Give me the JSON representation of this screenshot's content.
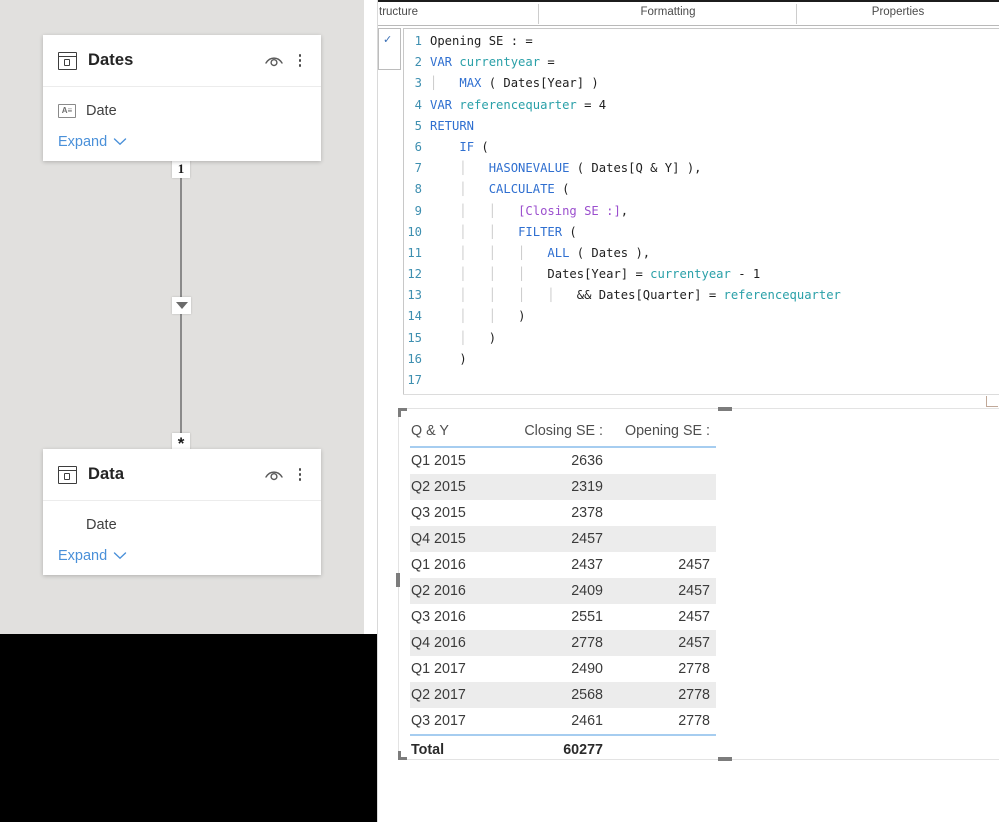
{
  "ribbon": {
    "groups": [
      {
        "label": "tructure",
        "name": "ribbon-group-structure"
      },
      {
        "label": "Formatting",
        "name": "ribbon-group-formatting"
      },
      {
        "label": "Properties",
        "name": "ribbon-group-properties"
      }
    ]
  },
  "formula_bar": {
    "commit_icon": "checkmark-icon",
    "commit_glyph": "✓"
  },
  "model_pane": {
    "tables": [
      {
        "name": "Dates",
        "icon": "table-icon",
        "hide_icon": "eye-hide-icon",
        "more_icon": "kebab-menu-icon",
        "fields": [
          {
            "label": "Date",
            "icon": "text-field-icon",
            "icon_text": "A≡"
          }
        ],
        "expand_label": "Expand",
        "expand_icon": "chevron-down-icon"
      },
      {
        "name": "Data",
        "icon": "table-icon",
        "hide_icon": "eye-hide-icon",
        "more_icon": "kebab-menu-icon",
        "fields": [
          {
            "label": "Date",
            "icon": "",
            "icon_text": ""
          }
        ],
        "expand_label": "Expand",
        "expand_icon": "chevron-down-icon"
      }
    ],
    "relationship": {
      "from_cardinality": "1",
      "to_cardinality": "*",
      "cross_filter_icon": "filter-direction-arrow-icon"
    }
  },
  "code": {
    "lines": [
      {
        "n": "1",
        "tokens": [
          {
            "t": "Opening SE : =",
            "c": "ctext"
          }
        ]
      },
      {
        "n": "2",
        "tokens": [
          {
            "t": "VAR ",
            "c": "k-fn"
          },
          {
            "t": "currentyear",
            "c": "k-var"
          },
          {
            "t": " =",
            "c": "ctext"
          }
        ]
      },
      {
        "n": "3",
        "tokens": [
          {
            "t": "│   ",
            "c": "guide"
          },
          {
            "t": "MAX",
            "c": "k-fn"
          },
          {
            "t": " ( Dates[Year] )",
            "c": "ctext"
          }
        ]
      },
      {
        "n": "4",
        "tokens": [
          {
            "t": "VAR ",
            "c": "k-fn"
          },
          {
            "t": "referencequarter",
            "c": "k-var"
          },
          {
            "t": " = 4",
            "c": "ctext"
          }
        ]
      },
      {
        "n": "5",
        "tokens": [
          {
            "t": "RETURN",
            "c": "k-fn"
          }
        ]
      },
      {
        "n": "6",
        "tokens": [
          {
            "t": "    ",
            "c": "ctext"
          },
          {
            "t": "IF",
            "c": "k-fn"
          },
          {
            "t": " (",
            "c": "ctext"
          }
        ]
      },
      {
        "n": "7",
        "tokens": [
          {
            "t": "    │   ",
            "c": "guide"
          },
          {
            "t": "HASONEVALUE",
            "c": "k-fn"
          },
          {
            "t": " ( Dates[Q & Y] ),",
            "c": "ctext"
          }
        ]
      },
      {
        "n": "8",
        "tokens": [
          {
            "t": "    │   ",
            "c": "guide"
          },
          {
            "t": "CALCULATE",
            "c": "k-fn"
          },
          {
            "t": " (",
            "c": "ctext"
          }
        ]
      },
      {
        "n": "9",
        "tokens": [
          {
            "t": "    │   │   ",
            "c": "guide"
          },
          {
            "t": "[Closing SE :]",
            "c": "k-meas"
          },
          {
            "t": ",",
            "c": "ctext"
          }
        ]
      },
      {
        "n": "10",
        "tokens": [
          {
            "t": "    │   │   ",
            "c": "guide"
          },
          {
            "t": "FILTER",
            "c": "k-fn"
          },
          {
            "t": " (",
            "c": "ctext"
          }
        ]
      },
      {
        "n": "11",
        "tokens": [
          {
            "t": "    │   │   │   ",
            "c": "guide"
          },
          {
            "t": "ALL",
            "c": "k-fn"
          },
          {
            "t": " ( Dates ),",
            "c": "ctext"
          }
        ]
      },
      {
        "n": "12",
        "tokens": [
          {
            "t": "    │   │   │   ",
            "c": "guide"
          },
          {
            "t": "Dates[Year] = ",
            "c": "ctext"
          },
          {
            "t": "currentyear",
            "c": "k-var"
          },
          {
            "t": " - 1",
            "c": "ctext"
          }
        ]
      },
      {
        "n": "13",
        "tokens": [
          {
            "t": "    │   │   │   │   ",
            "c": "guide"
          },
          {
            "t": "&& Dates[Quarter] = ",
            "c": "ctext"
          },
          {
            "t": "referencequarter",
            "c": "k-var"
          }
        ]
      },
      {
        "n": "14",
        "tokens": [
          {
            "t": "    │   │   ",
            "c": "guide"
          },
          {
            "t": ")",
            "c": "ctext"
          }
        ]
      },
      {
        "n": "15",
        "tokens": [
          {
            "t": "    │   ",
            "c": "guide"
          },
          {
            "t": ")",
            "c": "ctext"
          }
        ]
      },
      {
        "n": "16",
        "tokens": [
          {
            "t": "    ",
            "c": "guide"
          },
          {
            "t": ")",
            "c": "ctext"
          }
        ]
      },
      {
        "n": "17",
        "tokens": [
          {
            "t": "",
            "c": "ctext"
          }
        ]
      }
    ]
  },
  "visual": {
    "table": {
      "columns": [
        "Q & Y",
        "Closing SE :",
        "Opening SE :"
      ],
      "rows": [
        [
          "Q1 2015",
          "2636",
          ""
        ],
        [
          "Q2 2015",
          "2319",
          ""
        ],
        [
          "Q3 2015",
          "2378",
          ""
        ],
        [
          "Q4 2015",
          "2457",
          ""
        ],
        [
          "Q1 2016",
          "2437",
          "2457"
        ],
        [
          "Q2 2016",
          "2409",
          "2457"
        ],
        [
          "Q3 2016",
          "2551",
          "2457"
        ],
        [
          "Q4 2016",
          "2778",
          "2457"
        ],
        [
          "Q1 2017",
          "2490",
          "2778"
        ],
        [
          "Q2 2017",
          "2568",
          "2778"
        ],
        [
          "Q3 2017",
          "2461",
          "2778"
        ]
      ],
      "total_row": [
        "Total",
        "60277",
        ""
      ]
    }
  },
  "colors": {
    "pane_bg": "#e1e0de",
    "accent_link": "#4a90d9",
    "table_rule": "#a6cdf0",
    "alt_row": "#ececec",
    "code_function": "#2f6fd0",
    "code_variable": "#2aa0a8",
    "code_measure": "#9b4fce",
    "code_linenum": "#3e8fb0"
  }
}
